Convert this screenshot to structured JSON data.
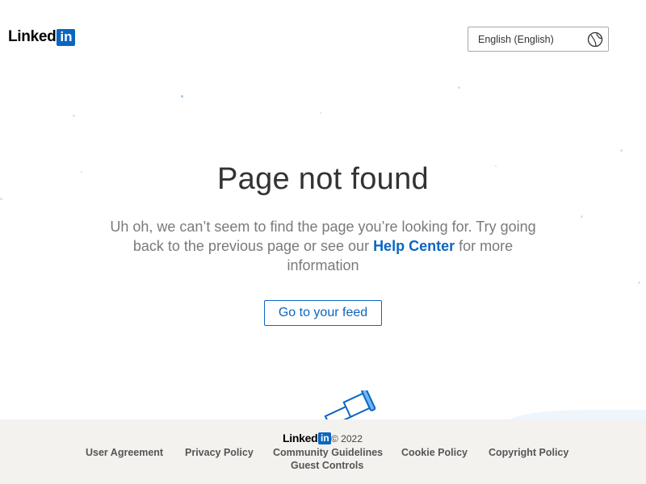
{
  "header": {
    "logo_word": "Linked",
    "logo_in": "in",
    "language": "English (English)",
    "globe_icon": "globe-icon"
  },
  "main": {
    "title": "Page not found",
    "message_before": "Uh oh, we can’t seem to find the page you’re looking for. Try going back to the previous page or see our ",
    "help_link": "Help Center",
    "message_after": " for more information",
    "feed_button": "Go to your feed"
  },
  "footer": {
    "logo_word": "Linked",
    "logo_in": "in",
    "copyright": "© 2022",
    "links": [
      "User Agreement",
      "Privacy Policy",
      "Community Guidelines",
      "Cookie Policy",
      "Copyright Policy",
      "Guest Controls"
    ]
  },
  "colors": {
    "brand": "#0a66c2",
    "footer_bg": "#f3f2ef",
    "title": "#333333",
    "body_text": "#7a7a7a"
  }
}
